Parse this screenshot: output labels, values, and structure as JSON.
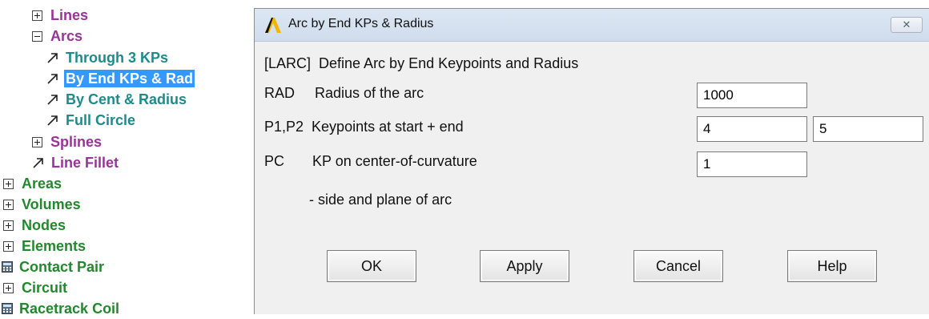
{
  "tree": {
    "lines": "Lines",
    "arcs": "Arcs",
    "through3": "Through 3 KPs",
    "byEnd": "By End KPs & Rad",
    "byCent": "By Cent & Radius",
    "fullCircle": "Full Circle",
    "splines": "Splines",
    "lineFillet": "Line Fillet",
    "areas": "Areas",
    "volumes": "Volumes",
    "nodes": "Nodes",
    "elements": "Elements",
    "contactPair": "Contact Pair",
    "circuit": "Circuit",
    "racetrack": "Racetrack Coil"
  },
  "colors": {
    "selection": "#3399ff",
    "purple": "#993399",
    "teal": "#1f8a8a",
    "green": "#22882e"
  },
  "dialog": {
    "title": "Arc by End KPs & Radius",
    "close_glyph": "✕",
    "heading": "[LARC]  Define Arc by End Keypoints and Radius",
    "rad_label": "RAD     Radius of the arc",
    "rad_value": "1000",
    "p1p2_label": "P1,P2  Keypoints at start + end",
    "p1_value": "4",
    "p2_value": "5",
    "pc_label": "PC       KP on center-of-curvature",
    "pc_value": "1",
    "pc_sub": "- side and plane of arc",
    "ok": "OK",
    "apply": "Apply",
    "cancel": "Cancel",
    "help": "Help"
  }
}
